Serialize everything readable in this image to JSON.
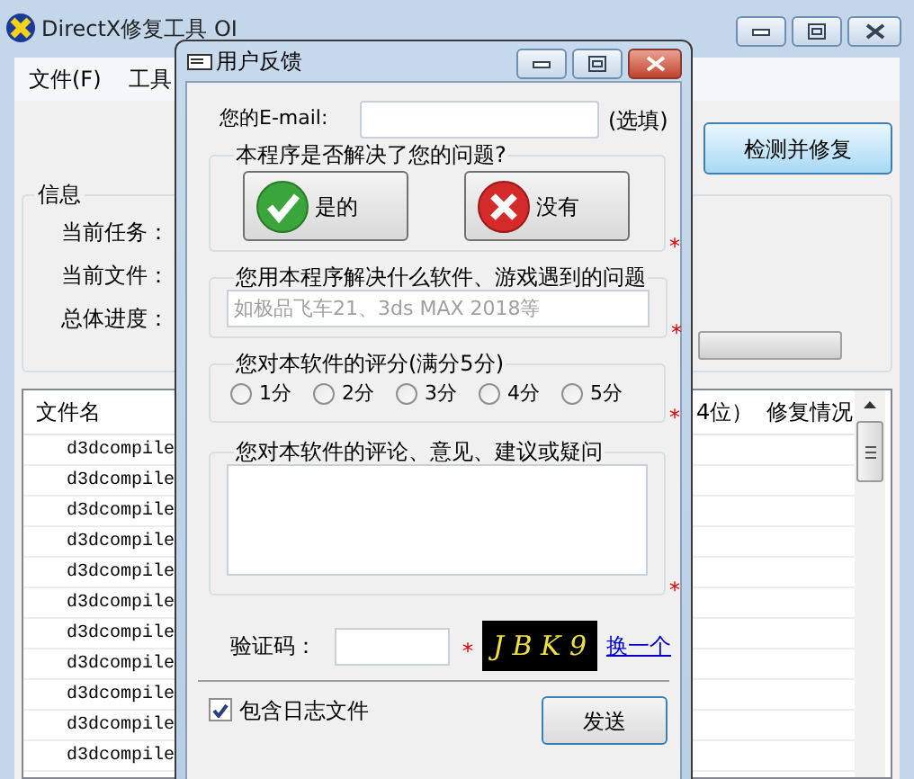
{
  "main_window": {
    "title": "DirectX修复工具 OI",
    "menu": [
      "文件(F)",
      "工具"
    ],
    "repair_button": "检测并修复",
    "info": {
      "title": "信息",
      "labels": [
        "当前任务：",
        "当前文件：",
        "总体进度："
      ],
      "progress": {
        "level": 0
      }
    },
    "table": {
      "columns": [
        "文件名",
        "4位）",
        "修复情况"
      ],
      "rows": [
        {
          "file": "d3dcompile"
        },
        {
          "file": "d3dcompile"
        },
        {
          "file": "d3dcompile"
        },
        {
          "file": "d3dcompile"
        },
        {
          "file": "d3dcompile"
        },
        {
          "file": "d3dcompile"
        },
        {
          "file": "d3dcompile"
        },
        {
          "file": "d3dcompile"
        },
        {
          "file": "d3dcompile"
        },
        {
          "file": "d3dcompile"
        },
        {
          "file": "d3dcompile"
        }
      ]
    }
  },
  "dialog": {
    "title": "用户反馈",
    "email": {
      "label": "您的E-mail:",
      "note": "(选填)"
    },
    "solved": {
      "legend": "本程序是否解决了您的问题?",
      "buttons": [
        {
          "kind": "yes",
          "label": "是的"
        },
        {
          "kind": "no",
          "label": "没有"
        }
      ],
      "required": "*"
    },
    "problem": {
      "legend": "您用本程序解决什么软件、游戏遇到的问题",
      "placeholder": "如极品飞车21、3ds MAX 2018等",
      "required": "*"
    },
    "rating": {
      "legend": "您对本软件的评分(满分5分)",
      "options": [
        {
          "label": "1分",
          "selected": false
        },
        {
          "label": "2分",
          "selected": false
        },
        {
          "label": "3分",
          "selected": false
        },
        {
          "label": "4分",
          "selected": false
        },
        {
          "label": "5分",
          "selected": false
        }
      ],
      "required": "*"
    },
    "comment": {
      "legend": "您对本软件的评论、意见、建议或疑问",
      "required": "*"
    },
    "captcha": {
      "label": "验证码：",
      "required": "*",
      "code": "J B K 9",
      "refresh_link": "换一个"
    },
    "include_log": {
      "label": "包含日志文件",
      "checked": true
    },
    "send_button": "发送"
  }
}
